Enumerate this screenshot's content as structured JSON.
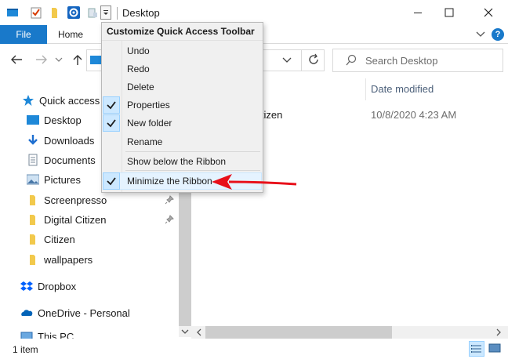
{
  "window": {
    "title": "Desktop"
  },
  "ribbon": {
    "tab_file": "File",
    "tab_home": "Home",
    "help": "?"
  },
  "search": {
    "placeholder": "Search Desktop"
  },
  "sidebar": {
    "items": [
      {
        "label": "Quick access",
        "icon": "star-icon"
      },
      {
        "label": "Desktop",
        "icon": "desktop-folder-icon"
      },
      {
        "label": "Downloads",
        "icon": "downloads-icon"
      },
      {
        "label": "Documents",
        "icon": "documents-icon"
      },
      {
        "label": "Pictures",
        "icon": "pictures-icon"
      },
      {
        "label": "Screenpresso",
        "icon": "folder-icon",
        "pinned": true
      },
      {
        "label": "Digital Citizen",
        "icon": "folder-icon",
        "pinned": true
      },
      {
        "label": "Citizen",
        "icon": "folder-icon"
      },
      {
        "label": "wallpapers",
        "icon": "folder-icon"
      },
      {
        "label": "Dropbox",
        "icon": "dropbox-icon"
      },
      {
        "label": "OneDrive - Personal",
        "icon": "onedrive-icon"
      },
      {
        "label": "This PC",
        "icon": "pc-icon"
      }
    ]
  },
  "content": {
    "column_date": "Date modified",
    "row_name": "itizen",
    "row_date": "10/8/2020 4:23 AM"
  },
  "status": {
    "item_count": "1 item"
  },
  "menu": {
    "title": "Customize Quick Access Toolbar",
    "items": [
      {
        "label": "Undo",
        "checked": false
      },
      {
        "label": "Redo",
        "checked": false
      },
      {
        "label": "Delete",
        "checked": false
      },
      {
        "label": "Properties",
        "checked": true
      },
      {
        "label": "New folder",
        "checked": true
      },
      {
        "label": "Rename",
        "checked": false
      },
      {
        "label": "Show below the Ribbon",
        "checked": false
      },
      {
        "label": "Minimize the Ribbon",
        "checked": true,
        "hovered": true
      }
    ]
  },
  "colors": {
    "accent": "#1979ca",
    "annotation_arrow": "#e8101a",
    "check_bg": "#cce8ff"
  }
}
